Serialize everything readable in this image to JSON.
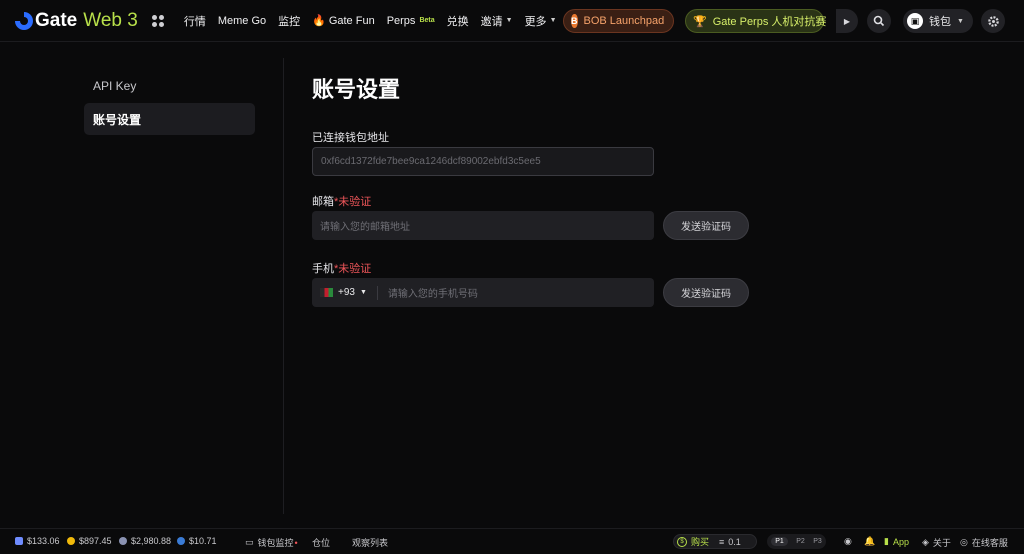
{
  "header": {
    "logo_text": "Gate",
    "logo_suffix": "Web 3",
    "nav": [
      {
        "label": "行情"
      },
      {
        "label": "Meme Go"
      },
      {
        "label": "监控"
      },
      {
        "label": "Gate Fun",
        "icon": "fire-icon"
      },
      {
        "label": "Perps",
        "badge": "Beta"
      },
      {
        "label": "兑换"
      },
      {
        "label": "邀请",
        "dropdown": true
      },
      {
        "label": "更多",
        "dropdown": true
      }
    ],
    "bob_launchpad": "BOB Launchpad",
    "perps_contest": "Gate Perps 人机对抗赛",
    "wallet_label": "钱包",
    "colors": {
      "accent": "#b8e04a",
      "bob": "#e8772e",
      "warn": "#f0565a"
    }
  },
  "sidebar": {
    "items": [
      {
        "label": "API Key",
        "active": false
      },
      {
        "label": "账号设置",
        "active": true
      }
    ]
  },
  "main": {
    "title": "账号设置",
    "wallet_label": "已连接钱包地址",
    "wallet_address": "0xf6cd1372fde7bee9ca1246dcf89002ebfd3c5ee5",
    "email_label": "邮箱",
    "email_status": "*未验证",
    "email_placeholder": "请输入您的邮箱地址",
    "email_button": "发送验证码",
    "phone_label": "手机",
    "phone_status": "*未验证",
    "phone_code": "+93",
    "phone_placeholder": "请输入您的手机号码",
    "phone_button": "发送验证码"
  },
  "footer": {
    "tickers": [
      {
        "value": "$133.06",
        "color": "#6f8cff"
      },
      {
        "value": "$897.45",
        "color": "#f0b90b"
      },
      {
        "value": "$2,980.88",
        "color": "#8a92b2"
      },
      {
        "value": "$10.71",
        "color": "#3a7bd5"
      }
    ],
    "wallet_monitor": "钱包监控",
    "positions": "仓位",
    "watchlist": "观察列表",
    "buy_label": "购买",
    "buy_amount": "0.1",
    "presets": [
      "P1",
      "P2",
      "P3"
    ],
    "app_label": "App",
    "about_label": "关于",
    "support_label": "在线客服"
  }
}
